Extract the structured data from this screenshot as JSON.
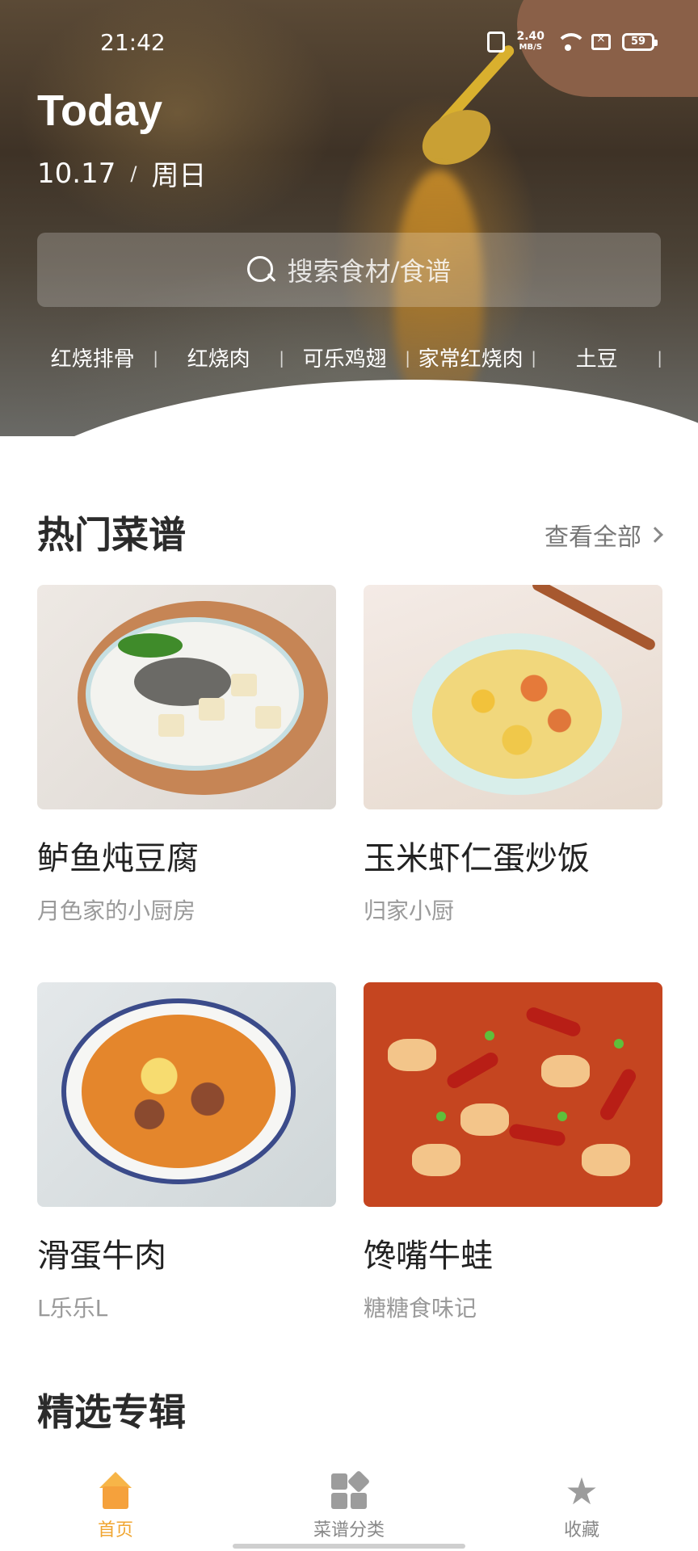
{
  "status_bar": {
    "time": "21:42",
    "net_speed_value": "2.40",
    "net_speed_unit": "MB/S",
    "battery": "59"
  },
  "hero": {
    "title": "Today",
    "date": "10.17",
    "date_separator": "/",
    "weekday": "周日"
  },
  "search": {
    "placeholder": "搜索食材/食谱"
  },
  "hot_tags": [
    "红烧排骨",
    "红烧肉",
    "可乐鸡翅",
    "家常红烧肉",
    "土豆"
  ],
  "tag_separator": "|",
  "popular": {
    "title": "热门菜谱",
    "view_all": "查看全部",
    "recipes": [
      {
        "name": "鲈鱼炖豆腐",
        "author": "月色家的小厨房",
        "image_icon": "fish-tofu-photo"
      },
      {
        "name": "玉米虾仁蛋炒饭",
        "author": "归家小厨",
        "image_icon": "fried-rice-photo"
      },
      {
        "name": "滑蛋牛肉",
        "author": "L乐乐L",
        "image_icon": "egg-beef-photo"
      },
      {
        "name": "馋嘴牛蛙",
        "author": "糖糖食味记",
        "image_icon": "spicy-bullfrog-photo"
      }
    ]
  },
  "featured": {
    "title": "精选专辑"
  },
  "bottom_nav": [
    {
      "label": "首页",
      "icon": "home-icon",
      "active": true
    },
    {
      "label": "菜谱分类",
      "icon": "category-icon",
      "active": false
    },
    {
      "label": "收藏",
      "icon": "star-icon",
      "active": false
    }
  ],
  "colors": {
    "accent": "#f0a632",
    "muted_text": "#9a9a9a"
  }
}
